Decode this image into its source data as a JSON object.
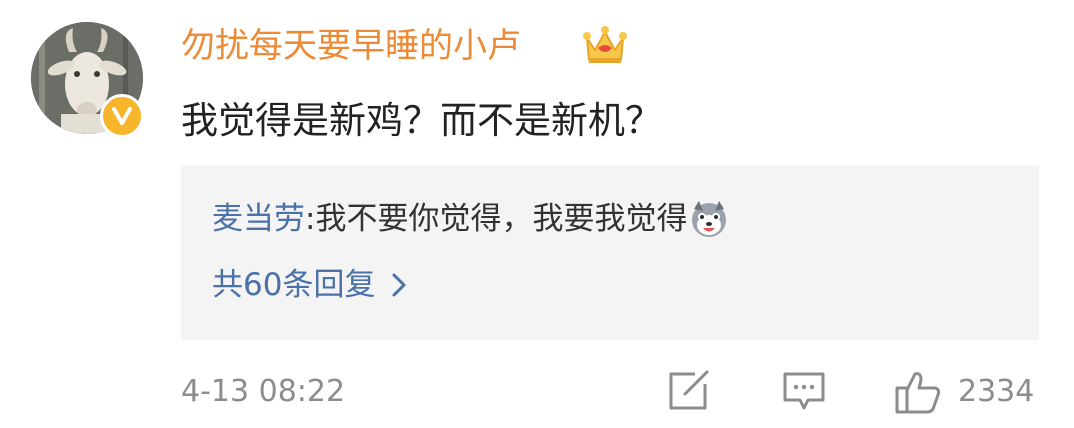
{
  "comment": {
    "username": "勿扰每天要早睡的小卢",
    "text": "我觉得是新鸡？而不是新机？",
    "avatar_icon": "goat-avatar",
    "badge_icon": "verified-v-icon",
    "member_icon": "crown-icon"
  },
  "reply": {
    "author": "麦当劳",
    "separator": ": ",
    "text": "我不要你觉得，我要我觉得",
    "emoji_icon": "husky-emoji-icon",
    "more_replies": "共60条回复"
  },
  "footer": {
    "timestamp": "4-13 08:22",
    "like_count": "2334"
  },
  "colors": {
    "username": "#ec8a35",
    "link_blue": "#4a71a8",
    "reply_background": "#f4f4f4",
    "meta_gray": "#8c8c8c",
    "badge": "#f7b52b"
  }
}
